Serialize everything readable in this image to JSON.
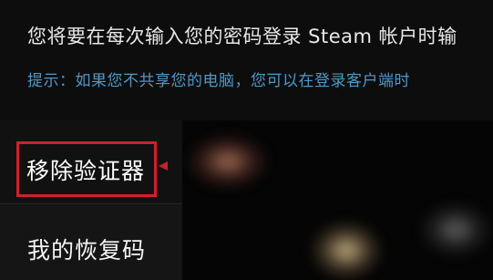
{
  "info": {
    "description": "您将要在每次输入您的密码登录 Steam 帐户时输",
    "hint": "提示：如果您不共享您的电脑，您可以在登录客户端时"
  },
  "menu": {
    "remove_authenticator": "移除验证器",
    "my_recovery_code": "我的恢复码"
  },
  "colors": {
    "highlight": "#d0202a",
    "hint_text": "#4f98c9"
  }
}
